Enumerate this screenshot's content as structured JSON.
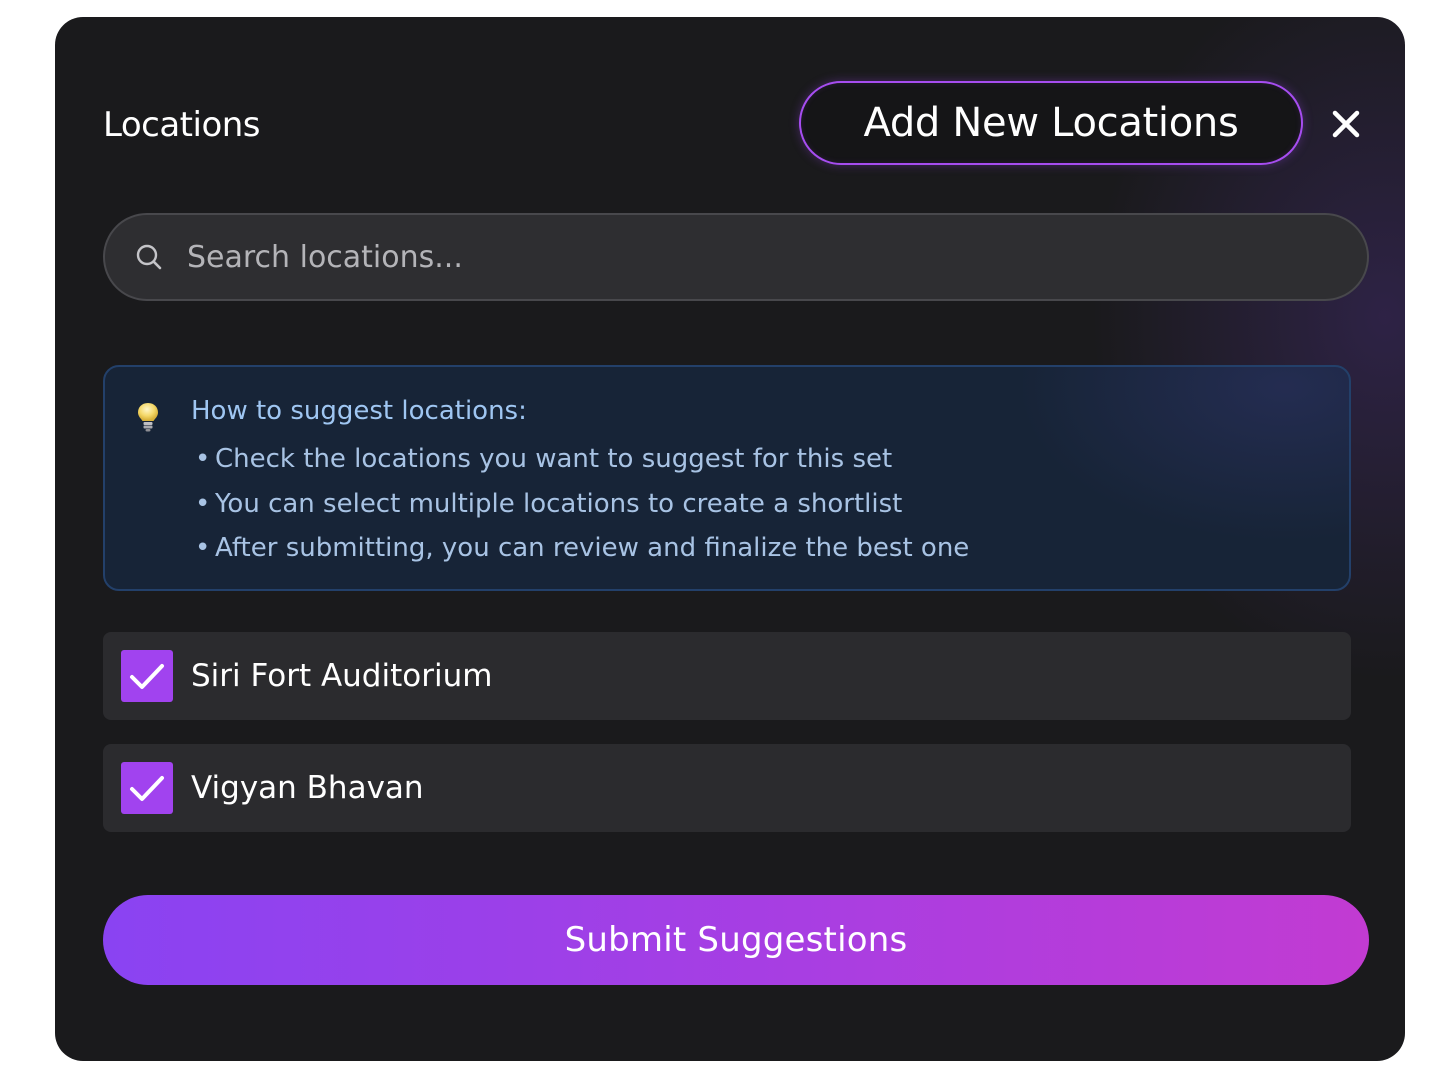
{
  "modal": {
    "title": "Locations",
    "add_button_label": "Add New Locations",
    "close_icon": "close-icon"
  },
  "search": {
    "placeholder": "Search locations...",
    "value": "",
    "icon": "search-icon"
  },
  "tips": {
    "icon": "lightbulb-icon",
    "title": "How to suggest locations:",
    "items": [
      "Check the locations you want to suggest for this set",
      "You can select multiple locations to create a shortlist",
      "After submitting, you can review and finalize the best one"
    ]
  },
  "locations": [
    {
      "label": "Siri Fort Auditorium",
      "checked": true
    },
    {
      "label": "Vigyan Bhavan",
      "checked": true
    }
  ],
  "submit_label": "Submit Suggestions",
  "colors": {
    "modal_background": "#1a1a1c",
    "accent_purple": "#a143ef",
    "tips_background": "#172437",
    "tips_text": "#a8c3e4",
    "submit_gradient_start": "#8a43f2",
    "submit_gradient_end": "#c23bd2"
  }
}
